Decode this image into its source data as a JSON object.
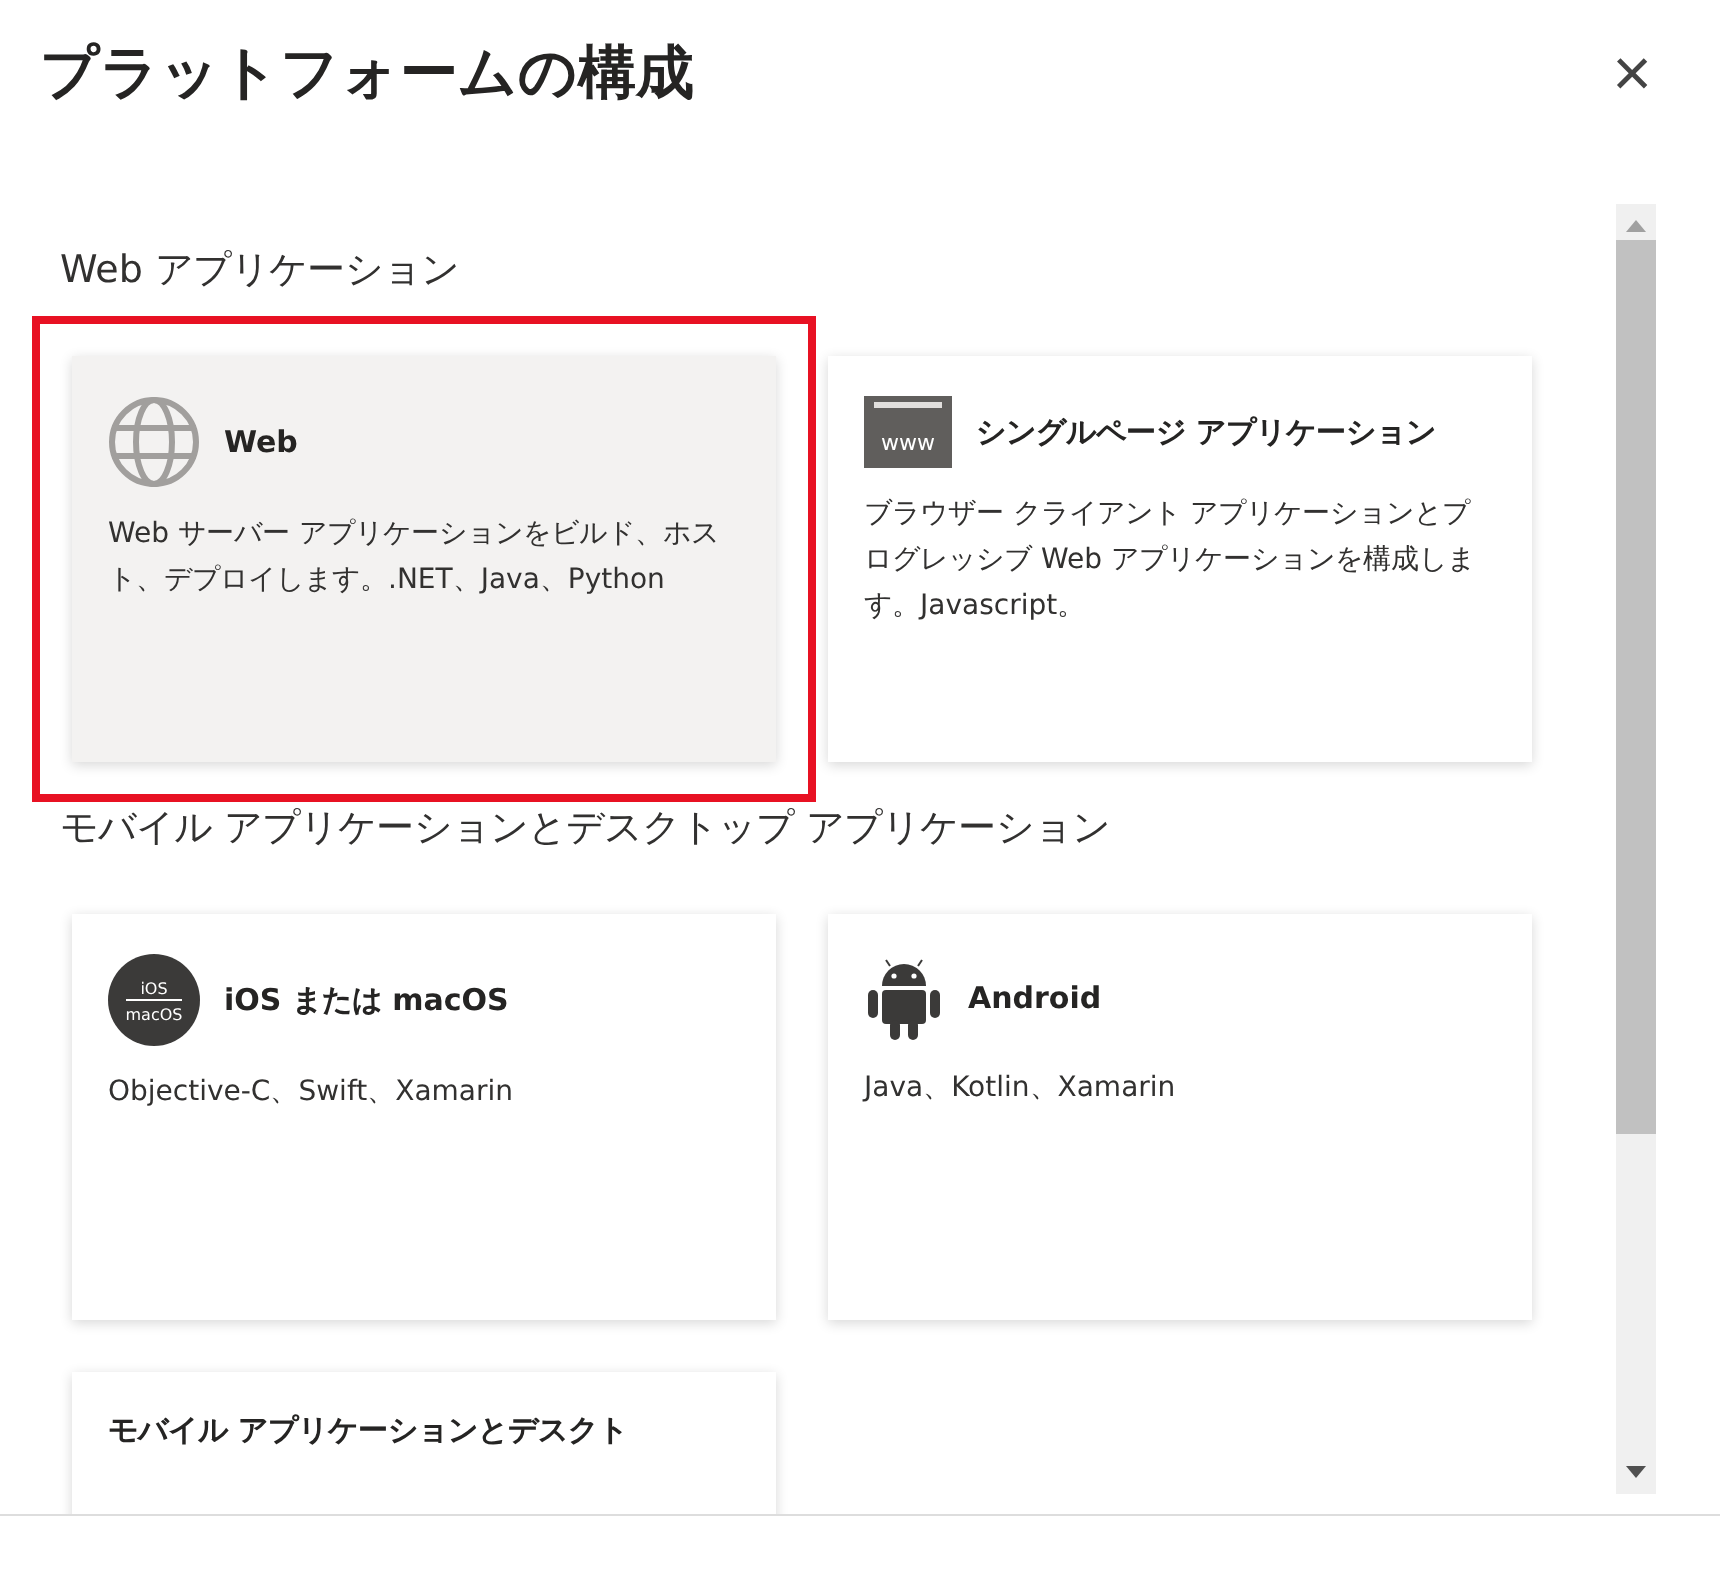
{
  "dialog": {
    "title": "プラットフォームの構成",
    "close": "×"
  },
  "sections": [
    {
      "heading": "Web アプリケーション",
      "cards": [
        {
          "kind": "globe",
          "title": "Web",
          "description": "Web サーバー アプリケーションをビルド、ホスト、デプロイします。.NET、Java、Python",
          "selected": true
        },
        {
          "kind": "www",
          "icon_text": [
            "www"
          ],
          "title": "シングルページ アプリケーション",
          "description": "ブラウザー クライアント アプリケーションとプログレッシブ Web アプリケーションを構成します。Javascript。",
          "selected": false
        }
      ]
    },
    {
      "heading": "モバイル アプリケーションとデスクトップ アプリケーション",
      "cards": [
        {
          "kind": "ios",
          "icon_text": [
            "iOS",
            "macOS"
          ],
          "title": "iOS または macOS",
          "description": "Objective-C、Swift、Xamarin",
          "selected": false
        },
        {
          "kind": "android",
          "title": "Android",
          "description": "Java、Kotlin、Xamarin",
          "selected": false
        },
        {
          "kind": "none",
          "title": "モバイル アプリケーションとデスクト",
          "selected": false
        }
      ]
    }
  ]
}
